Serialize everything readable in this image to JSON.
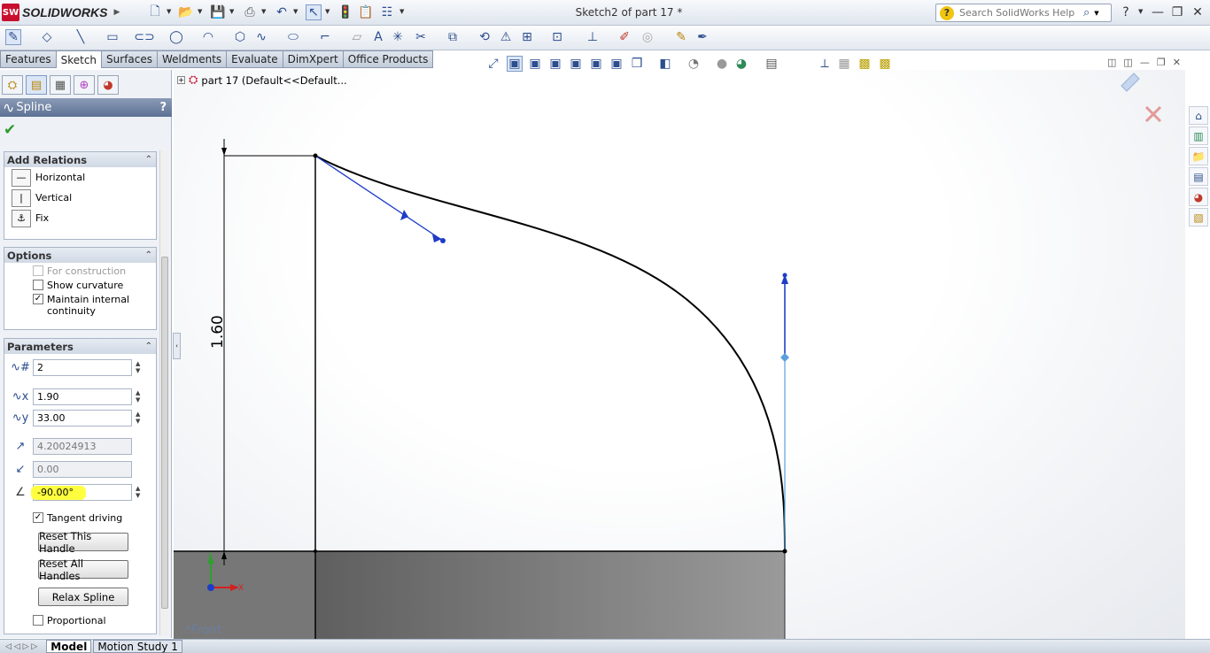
{
  "app": {
    "name": "SOLIDWORKS",
    "document_title": "Sketch2 of part 17 *"
  },
  "search": {
    "placeholder": "Search SolidWorks Help"
  },
  "command_tabs": [
    "Features",
    "Sketch",
    "Surfaces",
    "Weldments",
    "Evaluate",
    "DimXpert",
    "Office Products"
  ],
  "active_tab": "Sketch",
  "property_manager": {
    "title": "Spline",
    "help": "?",
    "add_relations": {
      "header": "Add Relations",
      "items": [
        {
          "label": "Horizontal",
          "icon": "horizontal-relation-icon"
        },
        {
          "label": "Vertical",
          "icon": "vertical-relation-icon"
        },
        {
          "label": "Fix",
          "icon": "fix-relation-icon"
        }
      ]
    },
    "options": {
      "header": "Options",
      "for_construction": {
        "label": "For construction",
        "checked": false,
        "disabled": true
      },
      "show_curvature": {
        "label": "Show curvature",
        "checked": false
      },
      "maintain_internal": {
        "label": "Maintain internal continuity",
        "checked": true
      }
    },
    "parameters": {
      "header": "Parameters",
      "point_number": "2",
      "x_coordinate": "1.90",
      "y_coordinate": "33.00",
      "tangent_weight_1": "4.20024913",
      "tangent_weight_2": "0.00",
      "tangent_angle": "-90.00°",
      "tangent_driving": {
        "label": "Tangent driving",
        "checked": true
      },
      "reset_handle": "Reset This Handle",
      "reset_all": "Reset All Handles",
      "relax": "Relax Spline",
      "proportional": {
        "label": "Proportional",
        "checked": false
      }
    }
  },
  "feature_tree": {
    "label": "part 17  (Default<<Default..."
  },
  "dimension": {
    "value": "1.60"
  },
  "view_label": "*Front",
  "triad": {
    "x": "X",
    "y": "Y"
  },
  "bottom_tabs": [
    "Model",
    "Motion Study 1"
  ],
  "active_bottom_tab": "Model",
  "colors": {
    "highlight": "#ffff40",
    "sketch_blue": "#1e3cc8",
    "floor_gray": "#6d6d6d"
  }
}
